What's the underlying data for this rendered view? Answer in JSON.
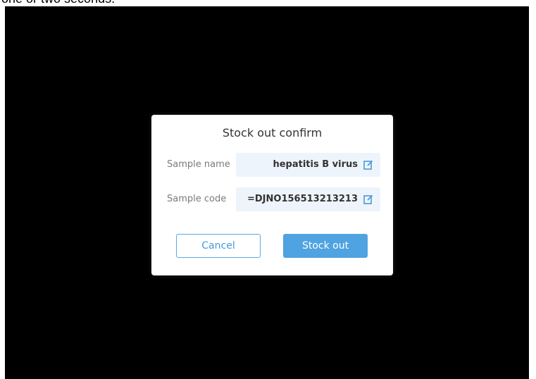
{
  "caption": "one or two seconds.",
  "dialog": {
    "title": "Stock out confirm",
    "fields": [
      {
        "label": "Sample name",
        "value": "hepatitis B virus",
        "icon": "edit-icon"
      },
      {
        "label": "Sample code",
        "value": "=DJNO156513213213",
        "icon": "edit-icon"
      }
    ],
    "cancel_label": "Cancel",
    "confirm_label": "Stock out"
  },
  "colors": {
    "accent": "#4fa3e0",
    "field_bg": "#eef4fb",
    "screen_bg": "#000000"
  }
}
